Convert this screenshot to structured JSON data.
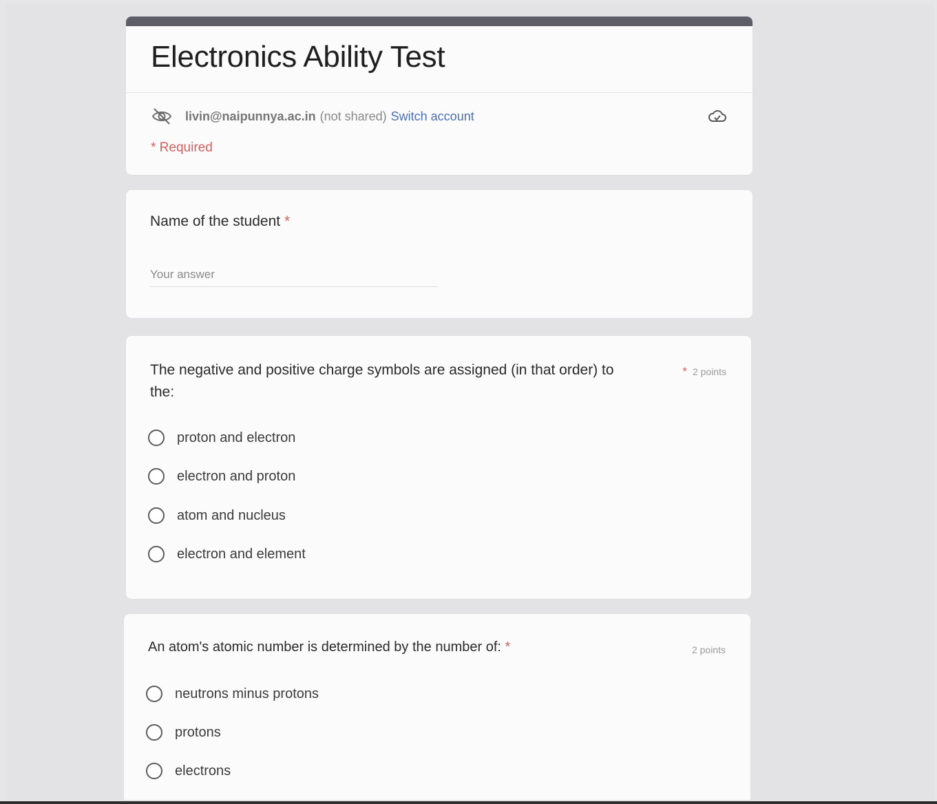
{
  "form": {
    "title": "Electronics Ability Test",
    "account": {
      "email": "livin@naipunnya.ac.in",
      "shared_status": "(not shared)",
      "switch_label": "Switch account"
    },
    "required_note": "* Required"
  },
  "questions": [
    {
      "title": "Name of the student",
      "required_mark": "*",
      "answer_placeholder": "Your answer",
      "answer_value": ""
    },
    {
      "title_line1": "The negative and positive charge symbols are assigned (in that order) to",
      "title_line2": "the:",
      "required_mark": "*",
      "points": "2 points",
      "options": [
        "proton and electron",
        "electron and proton",
        "atom and nucleus",
        "electron and element"
      ]
    },
    {
      "title": "An atom's atomic number is determined by the number of:",
      "required_mark": "*",
      "points": "2 points",
      "options": [
        "neutrons minus protons",
        "protons",
        "electrons"
      ]
    }
  ],
  "colors": {
    "header_bar": "#5e5e68",
    "required": "#d35f5f",
    "link": "#4a6fb8"
  },
  "icons": {
    "visibility": "eye-off-icon",
    "cloud": "cloud-check-icon",
    "radio": "radio-unchecked-icon"
  }
}
